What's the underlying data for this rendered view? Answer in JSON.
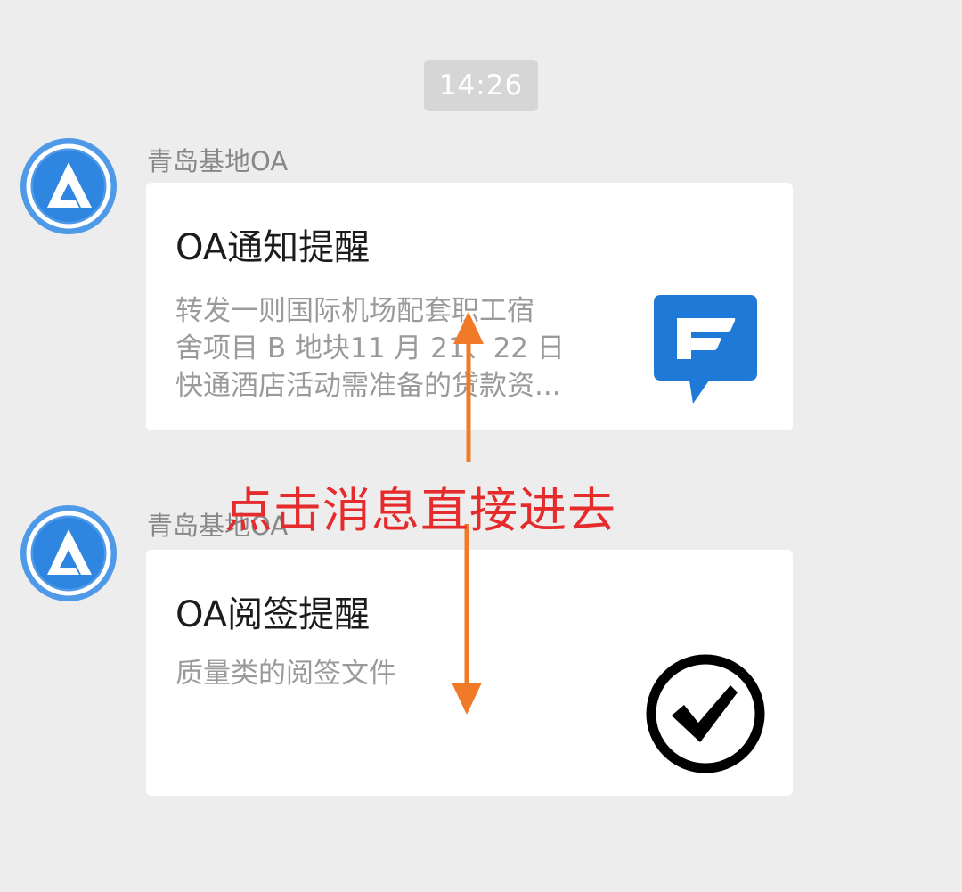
{
  "timestamp": "14:26",
  "messages": [
    {
      "sender": "青岛基地OA",
      "title": "OA通知提醒",
      "description_lines": [
        "转发一则国际机场配套职工宿",
        "舍项目 B 地块11 月 21、22 日",
        "快通酒店活动需准备的贷款资..."
      ],
      "icon": "blue-chat-bubble-icon"
    },
    {
      "sender": "青岛基地OA",
      "title": "OA阅签提醒",
      "description_lines": [
        "质量类的阅签文件"
      ],
      "icon": "checkmark-circle-icon"
    }
  ],
  "annotation": {
    "text": "点击消息直接进去",
    "color": "#e52b2b",
    "arrow_color": "#f07a28"
  },
  "colors": {
    "background": "#ededed",
    "avatar_blue": "#3f8ee6",
    "icon_blue": "#1e7ad6"
  }
}
